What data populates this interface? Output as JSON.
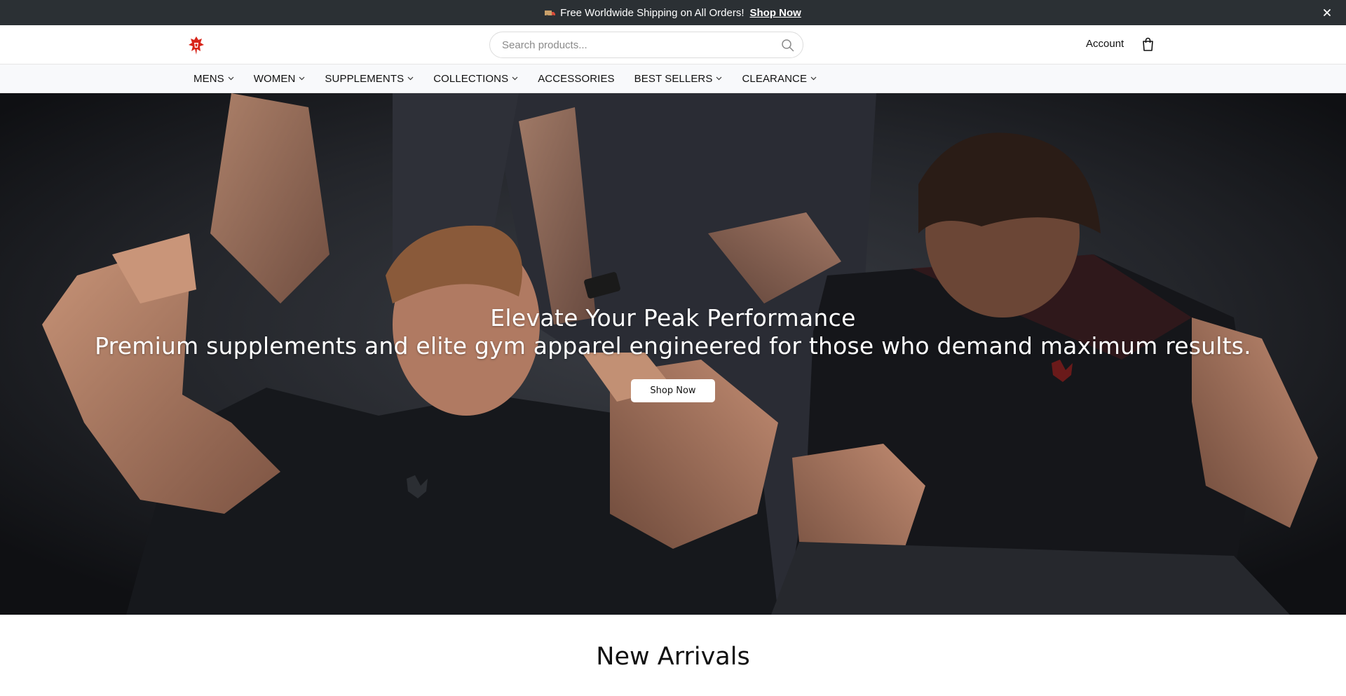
{
  "announcement": {
    "text": "Free Worldwide Shipping on All Orders!",
    "link_label": "Shop Now",
    "truck_icon": "delivery-truck-icon",
    "close_icon": "close-icon"
  },
  "header": {
    "logo": "brand-logo-icon",
    "search": {
      "placeholder": "Search products...",
      "value": ""
    },
    "account_label": "Account",
    "cart_icon": "shopping-bag-icon"
  },
  "nav": {
    "items": [
      {
        "label": "MENS",
        "has_dropdown": true
      },
      {
        "label": "WOMEN",
        "has_dropdown": true
      },
      {
        "label": "SUPPLEMENTS",
        "has_dropdown": true
      },
      {
        "label": "COLLECTIONS",
        "has_dropdown": true
      },
      {
        "label": "ACCESSORIES",
        "has_dropdown": false
      },
      {
        "label": "BEST SELLERS",
        "has_dropdown": true
      },
      {
        "label": "CLEARANCE",
        "has_dropdown": true
      }
    ]
  },
  "hero": {
    "headline": "Elevate Your Peak Performance",
    "subheadline": "Premium supplements and elite gym apparel engineered for those who demand maximum results.",
    "cta_label": "Shop Now"
  },
  "sections": {
    "new_arrivals_title": "New Arrivals"
  },
  "colors": {
    "announcement_bg": "#2b3034",
    "nav_bg": "#f8f9fb",
    "brand_red": "#d8261b",
    "hero_bg": "#1b1d21"
  }
}
